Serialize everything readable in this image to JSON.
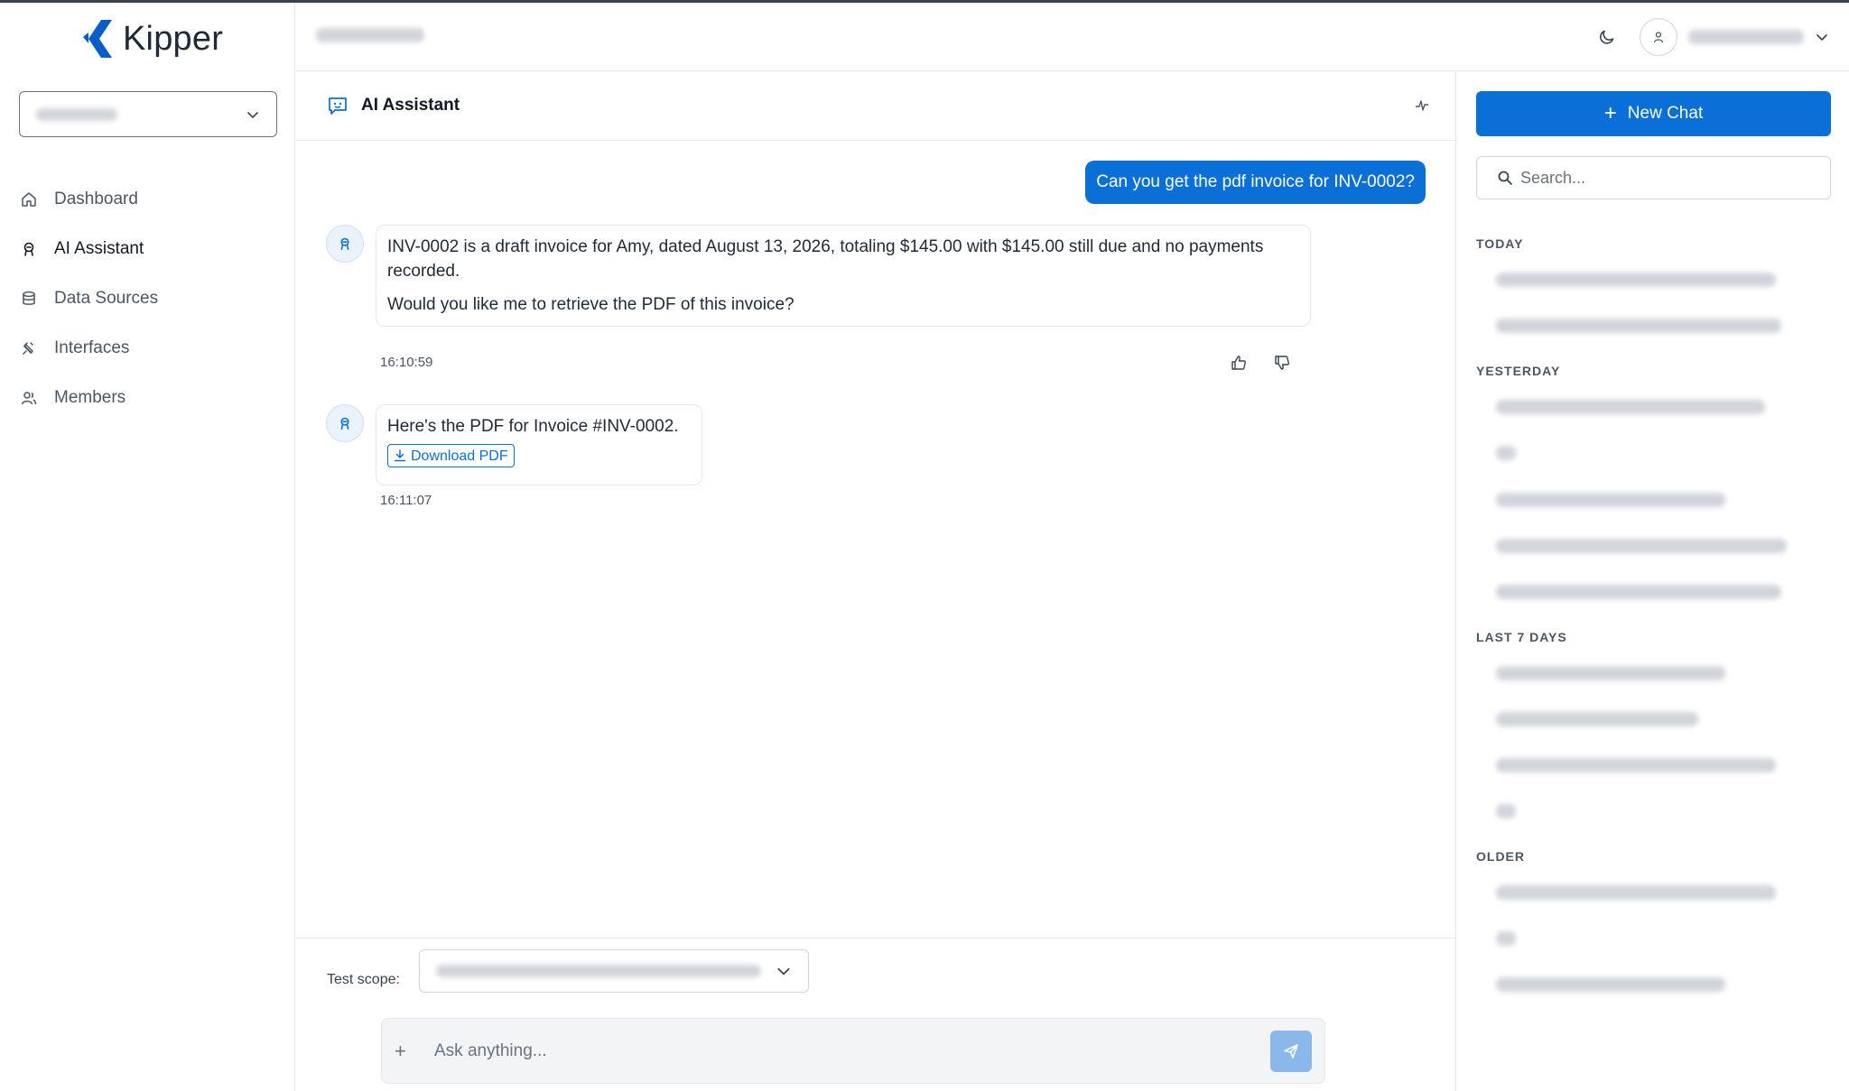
{
  "app": {
    "name": "Kipper"
  },
  "sidebar": {
    "items": [
      {
        "label": "Dashboard",
        "icon": "home-icon"
      },
      {
        "label": "AI Assistant",
        "icon": "assistant-icon"
      },
      {
        "label": "Data Sources",
        "icon": "database-icon"
      },
      {
        "label": "Interfaces",
        "icon": "plug-icon"
      },
      {
        "label": "Members",
        "icon": "users-icon"
      }
    ]
  },
  "chat": {
    "title": "AI Assistant",
    "messages": [
      {
        "role": "user",
        "text": "Can you get the pdf invoice for INV-0002?"
      },
      {
        "role": "assistant",
        "paragraphs": [
          "INV-0002 is a draft invoice for Amy, dated August 13, 2026, totaling $145.00 with $145.00 still due and no payments recorded.",
          "Would you like me to retrieve the PDF of this invoice?"
        ],
        "time": "16:10:59"
      },
      {
        "role": "assistant",
        "text": "Here's the PDF for Invoice #INV-0002.",
        "button": "Download PDF",
        "time": "16:11:07"
      }
    ],
    "scope_label": "Test scope:",
    "input_placeholder": "Ask anything..."
  },
  "history": {
    "new_chat_label": "New Chat",
    "search_placeholder": "Search...",
    "groups": [
      {
        "label": "TODAY"
      },
      {
        "label": "YESTERDAY"
      },
      {
        "label": "LAST 7 DAYS"
      },
      {
        "label": "OLDER"
      }
    ]
  },
  "colors": {
    "accent": "#0a6fd6",
    "send_disabled": "#8ab8ea"
  }
}
